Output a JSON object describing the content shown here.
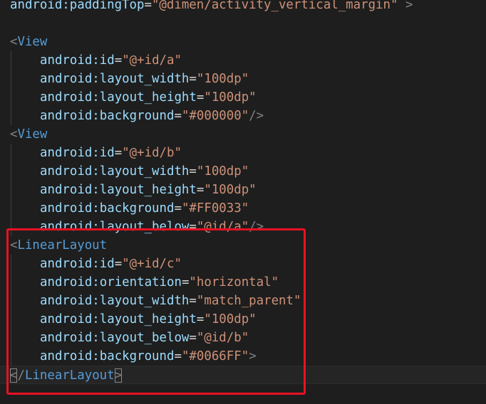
{
  "editor": {
    "lines": [
      {
        "indent": 0,
        "parts": [
          {
            "t": "android:paddingTop",
            "c": "attr"
          },
          {
            "t": "=",
            "c": "eq"
          },
          {
            "t": "\"@dimen/activity_vertical_margin\"",
            "c": "str"
          },
          {
            "t": " >",
            "c": "bracket"
          }
        ]
      },
      {
        "indent": 0,
        "parts": []
      },
      {
        "indent": 0,
        "parts": [
          {
            "t": "<",
            "c": "bracket"
          },
          {
            "t": "View",
            "c": "tag"
          }
        ]
      },
      {
        "indent": 1,
        "parts": [
          {
            "t": "android:id",
            "c": "attr"
          },
          {
            "t": "=",
            "c": "eq"
          },
          {
            "t": "\"@+id/a\"",
            "c": "str"
          }
        ]
      },
      {
        "indent": 1,
        "parts": [
          {
            "t": "android:layout_width",
            "c": "attr"
          },
          {
            "t": "=",
            "c": "eq"
          },
          {
            "t": "\"100dp\"",
            "c": "str"
          }
        ]
      },
      {
        "indent": 1,
        "parts": [
          {
            "t": "android:layout_height",
            "c": "attr"
          },
          {
            "t": "=",
            "c": "eq"
          },
          {
            "t": "\"100dp\"",
            "c": "str"
          }
        ]
      },
      {
        "indent": 1,
        "parts": [
          {
            "t": "android:background",
            "c": "attr"
          },
          {
            "t": "=",
            "c": "eq"
          },
          {
            "t": "\"#000000\"",
            "c": "str"
          },
          {
            "t": "/>",
            "c": "bracket"
          }
        ]
      },
      {
        "indent": 0,
        "parts": [
          {
            "t": "<",
            "c": "bracket"
          },
          {
            "t": "View",
            "c": "tag"
          }
        ]
      },
      {
        "indent": 1,
        "parts": [
          {
            "t": "android:id",
            "c": "attr"
          },
          {
            "t": "=",
            "c": "eq"
          },
          {
            "t": "\"@+id/b\"",
            "c": "str"
          }
        ]
      },
      {
        "indent": 1,
        "parts": [
          {
            "t": "android:layout_width",
            "c": "attr"
          },
          {
            "t": "=",
            "c": "eq"
          },
          {
            "t": "\"100dp\"",
            "c": "str"
          }
        ]
      },
      {
        "indent": 1,
        "parts": [
          {
            "t": "android:layout_height",
            "c": "attr"
          },
          {
            "t": "=",
            "c": "eq"
          },
          {
            "t": "\"100dp\"",
            "c": "str"
          }
        ]
      },
      {
        "indent": 1,
        "parts": [
          {
            "t": "android:background",
            "c": "attr"
          },
          {
            "t": "=",
            "c": "eq"
          },
          {
            "t": "\"#FF0033\"",
            "c": "str"
          }
        ]
      },
      {
        "indent": 1,
        "parts": [
          {
            "t": "android:layout_below",
            "c": "attr"
          },
          {
            "t": "=",
            "c": "eq"
          },
          {
            "t": "\"@id/a\"",
            "c": "str"
          },
          {
            "t": "/>",
            "c": "bracket"
          }
        ]
      },
      {
        "indent": 0,
        "parts": [
          {
            "t": "<",
            "c": "bracket"
          },
          {
            "t": "LinearLayout",
            "c": "tag"
          }
        ]
      },
      {
        "indent": 1,
        "parts": [
          {
            "t": "android:id",
            "c": "attr"
          },
          {
            "t": "=",
            "c": "eq"
          },
          {
            "t": "\"@+id/c\"",
            "c": "str"
          }
        ]
      },
      {
        "indent": 1,
        "parts": [
          {
            "t": "android:orientation",
            "c": "attr"
          },
          {
            "t": "=",
            "c": "eq"
          },
          {
            "t": "\"horizontal\"",
            "c": "str"
          }
        ]
      },
      {
        "indent": 1,
        "parts": [
          {
            "t": "android:layout_width",
            "c": "attr"
          },
          {
            "t": "=",
            "c": "eq"
          },
          {
            "t": "\"match_parent\"",
            "c": "str"
          }
        ]
      },
      {
        "indent": 1,
        "parts": [
          {
            "t": "android:layout_height",
            "c": "attr"
          },
          {
            "t": "=",
            "c": "eq"
          },
          {
            "t": "\"100dp\"",
            "c": "str"
          }
        ]
      },
      {
        "indent": 1,
        "parts": [
          {
            "t": "android:layout_below",
            "c": "attr"
          },
          {
            "t": "=",
            "c": "eq"
          },
          {
            "t": "\"@id/b\"",
            "c": "str"
          }
        ]
      },
      {
        "indent": 1,
        "parts": [
          {
            "t": "android:background",
            "c": "attr"
          },
          {
            "t": "=",
            "c": "eq"
          },
          {
            "t": "\"#0066FF\"",
            "c": "str"
          },
          {
            "t": ">",
            "c": "bracket"
          }
        ]
      },
      {
        "indent": 0,
        "current": true,
        "parts": [
          {
            "t": "<",
            "c": "bracket",
            "match": true
          },
          {
            "t": "/",
            "c": "bracket"
          },
          {
            "t": "LinearLayout",
            "c": "tag"
          },
          {
            "t": ">",
            "c": "bracket",
            "match": true
          }
        ]
      }
    ]
  },
  "colors": {
    "background": "#1e1e1e",
    "attribute": "#9cdcfe",
    "tag": "#569cd6",
    "string": "#ce9178",
    "punctuation": "#808080",
    "annotation_box": "#e81123"
  }
}
